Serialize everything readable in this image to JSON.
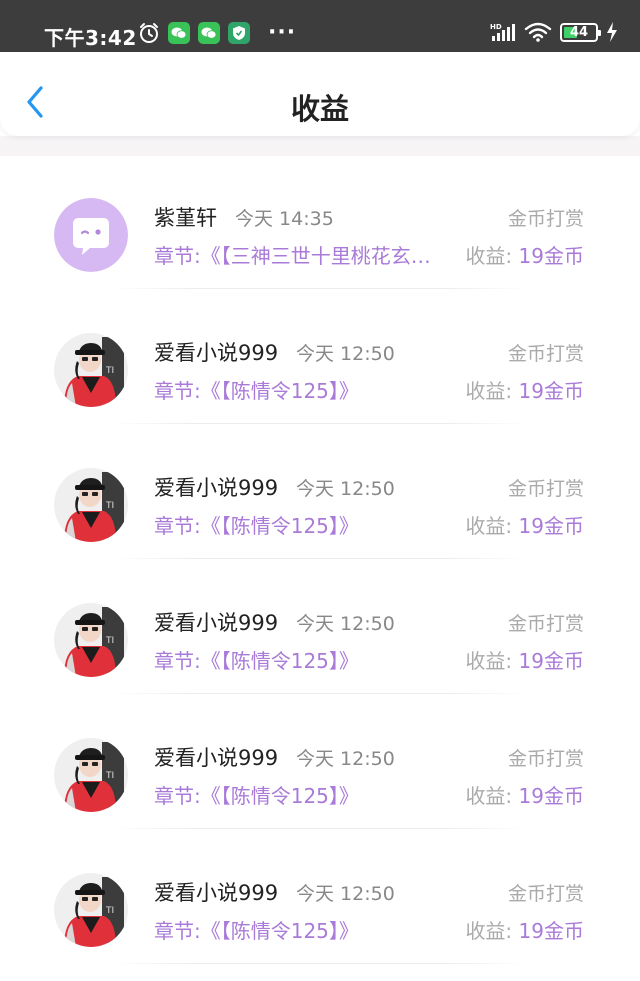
{
  "status_bar": {
    "time": "下午3:42",
    "network": "HD",
    "battery": "44",
    "battery_level": 0.44,
    "more": "···",
    "app_color": "#38c257"
  },
  "header": {
    "title": "收益",
    "back_icon": "chevron-left-icon",
    "accent": "#2196f3"
  },
  "records": [
    {
      "avatar": "default-chat-avatar",
      "name": "紫堇轩",
      "time": "今天 14:35",
      "type": "金币打赏",
      "chapter": "章节:《【三神三世十里桃花玄…",
      "earn_label": "收益: ",
      "earn_value": "19金币"
    },
    {
      "avatar": "user-photo-avatar",
      "name": "爱看小说999",
      "time": "今天 12:50",
      "type": "金币打赏",
      "chapter": "章节:《【陈情令125】》",
      "earn_label": "收益: ",
      "earn_value": "19金币"
    },
    {
      "avatar": "user-photo-avatar",
      "name": "爱看小说999",
      "time": "今天 12:50",
      "type": "金币打赏",
      "chapter": "章节:《【陈情令125】》",
      "earn_label": "收益: ",
      "earn_value": "19金币"
    },
    {
      "avatar": "user-photo-avatar",
      "name": "爱看小说999",
      "time": "今天 12:50",
      "type": "金币打赏",
      "chapter": "章节:《【陈情令125】》",
      "earn_label": "收益: ",
      "earn_value": "19金币"
    },
    {
      "avatar": "user-photo-avatar",
      "name": "爱看小说999",
      "time": "今天 12:50",
      "type": "金币打赏",
      "chapter": "章节:《【陈情令125】》",
      "earn_label": "收益: ",
      "earn_value": "19金币"
    },
    {
      "avatar": "user-photo-avatar",
      "name": "爱看小说999",
      "time": "今天 12:50",
      "type": "金币打赏",
      "chapter": "章节:《【陈情令125】》",
      "earn_label": "收益: ",
      "earn_value": "19金币"
    }
  ],
  "colors": {
    "purple": "#a97ad8",
    "avatar_default_bg": "#d6b9f2",
    "photo_jacket": "#e0303a"
  }
}
